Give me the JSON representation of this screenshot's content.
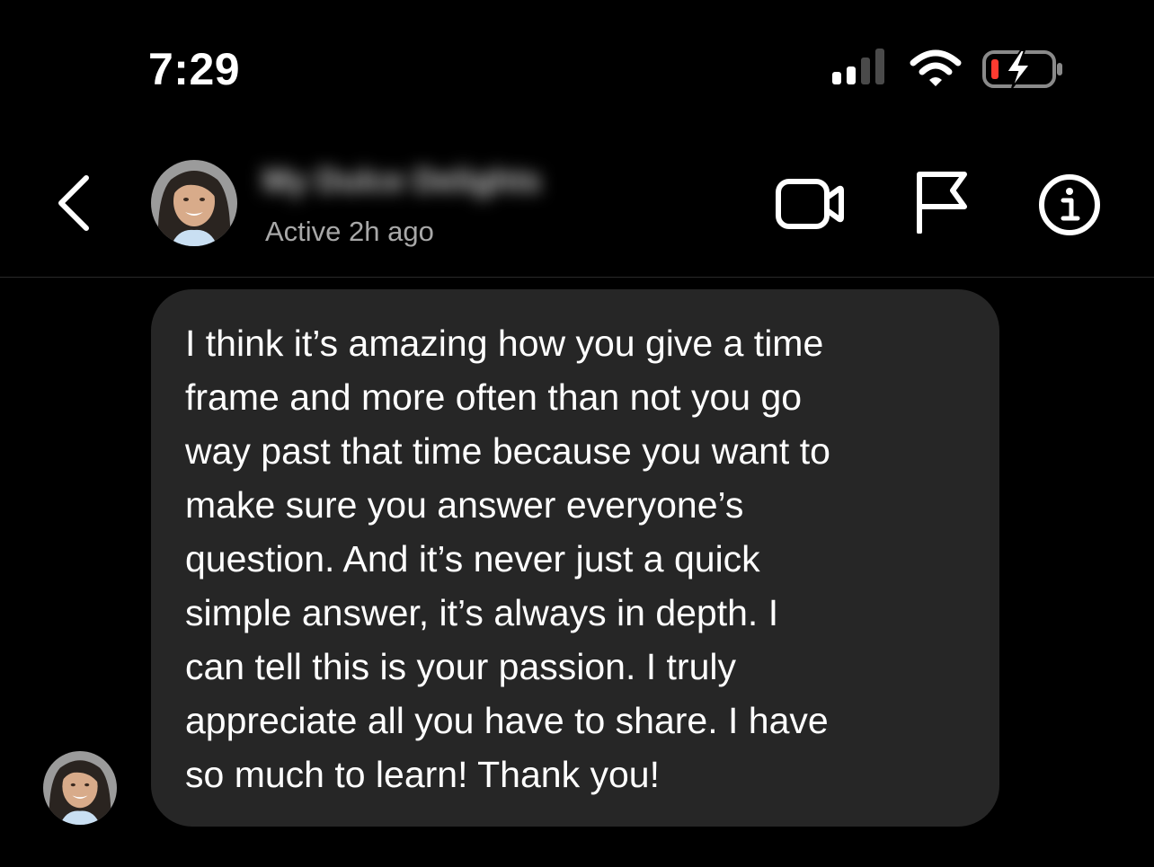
{
  "status_bar": {
    "time": "7:29",
    "signal_icon": "cellular-signal-icon",
    "wifi_icon": "wifi-icon",
    "battery_icon": "battery-charging-icon",
    "battery_low_color": "#ff3b30"
  },
  "header": {
    "back_icon": "chevron-left-icon",
    "contact_name": "My Dulce Delights",
    "active_status": "Active 2h ago",
    "actions": [
      {
        "name": "video-call-button",
        "icon": "video-camera-icon"
      },
      {
        "name": "report-button",
        "icon": "flag-icon"
      },
      {
        "name": "info-button",
        "icon": "info-icon"
      }
    ]
  },
  "message": {
    "lines": [
      "I think it’s amazing how you give a time",
      "frame and more often than not you go",
      "way past that time because you want to",
      "make sure you answer everyone’s",
      "question. And it’s never just a quick",
      "simple answer, it’s always in depth. I",
      "can tell this is your passion. I truly",
      "appreciate all you have to share. I have",
      "so much to learn! Thank you!"
    ]
  },
  "colors": {
    "background": "#000000",
    "bubble": "#262626",
    "secondary_text": "#a8a8a8"
  }
}
